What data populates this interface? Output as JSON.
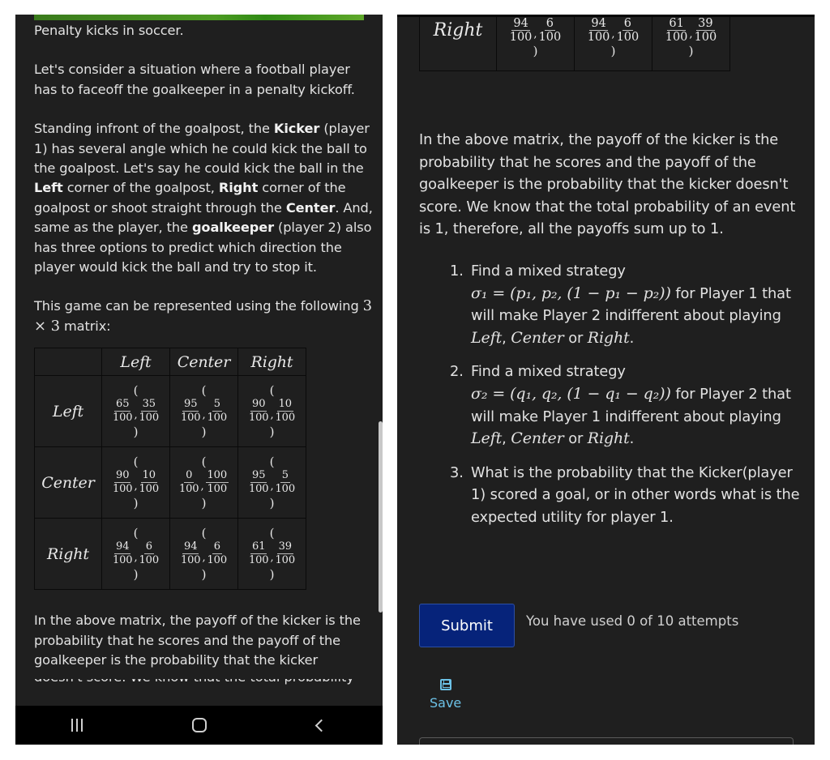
{
  "left": {
    "intro_title": "Penalty kicks in soccer.",
    "intro_para": "Let's consider a situation where a football player has to faceoff the goalkeeper in a penalty kickoff.",
    "desc": {
      "t1": "Standing infront of the goalpost, the ",
      "kicker": "Kicker",
      "t2": " (player 1) has several angle which he could kick the ball to the goalpost. Let's say he could kick the ball in the ",
      "left": "Left",
      "t3": " corner of the goalpost, ",
      "right": "Right",
      "t4": " corner of the goalpost or shoot straight through the ",
      "center": "Center",
      "t5": ". And, same as the player, the ",
      "goalkeeper": "goalkeeper",
      "t6": " (player 2) also has three options to predict which direction the player would kick the ball and try to stop it."
    },
    "matrix_intro_1": "This game can be represented using the following ",
    "matrix_dims": "3 × 3",
    "matrix_intro_2": " matrix:",
    "after_matrix": "In the above matrix, the payoff of the kicker is the probability that he scores and the payoff of the goalkeeper is the probability that the kicker",
    "cutoff_text": "doesn't score. We know that the total probability"
  },
  "matrix": {
    "columns": [
      "Left",
      "Center",
      "Right"
    ],
    "rows": [
      {
        "label": "Left",
        "cells": [
          {
            "a": "65",
            "b": "35",
            "den": "100"
          },
          {
            "a": "95",
            "b": "5",
            "den": "100"
          },
          {
            "a": "90",
            "b": "10",
            "den": "100"
          }
        ]
      },
      {
        "label": "Center",
        "cells": [
          {
            "a": "90",
            "b": "10",
            "den": "100"
          },
          {
            "a": "0",
            "b": "100",
            "den": "100"
          },
          {
            "a": "95",
            "b": "5",
            "den": "100"
          }
        ]
      },
      {
        "label": "Right",
        "cells": [
          {
            "a": "94",
            "b": "6",
            "den": "100"
          },
          {
            "a": "94",
            "b": "6",
            "den": "100"
          },
          {
            "a": "61",
            "b": "39",
            "den": "100"
          }
        ]
      }
    ],
    "open_paren": "(",
    "close_paren": ")",
    "comma": ","
  },
  "right": {
    "payoff_para": "In the above matrix, the payoff of the kicker is the probability that he scores and the payoff of the goalkeeper is the probability that the kicker doesn't score. We know that the total probability of an event is 1, therefore, all the payoffs sum up to 1.",
    "questions": [
      {
        "num": "1.",
        "t1": "Find a mixed strategy",
        "formula": "σ₁ = (p₁, p₂, (1 − p₁ − p₂))",
        "t2": " for Player 1 that will make Player 2 indifferent about playing ",
        "m1": "Left",
        "c1": ", ",
        "m2": "Center",
        "or": " or ",
        "m3": "Right",
        "end": "."
      },
      {
        "num": "2.",
        "t1": "Find a mixed strategy",
        "formula": "σ₂ = (q₁, q₂, (1 − q₁ − q₂))",
        "t2": " for Player 2 that will make Player 1 indifferent about playing ",
        "m1": "Left",
        "c1": ", ",
        "m2": "Center",
        "or": " or ",
        "m3": "Right",
        "end": "."
      },
      {
        "num": "3.",
        "text": "What is the probability that the Kicker(player 1) scored a goal, or in other words what is the expected utility for player 1."
      }
    ],
    "submit_label": "Submit",
    "attempts_text": "You have used 0 of 10 attempts",
    "save_label": "Save"
  },
  "colors": {
    "background": "#1f1f1f",
    "submit": "#06237a",
    "save_link": "#6cc1e6",
    "progress_green": "#4c9a22"
  },
  "icons": {
    "nav_recent": "recent-apps-icon",
    "nav_home": "home-icon",
    "nav_back": "back-icon",
    "save": "floppy-disk-icon"
  }
}
